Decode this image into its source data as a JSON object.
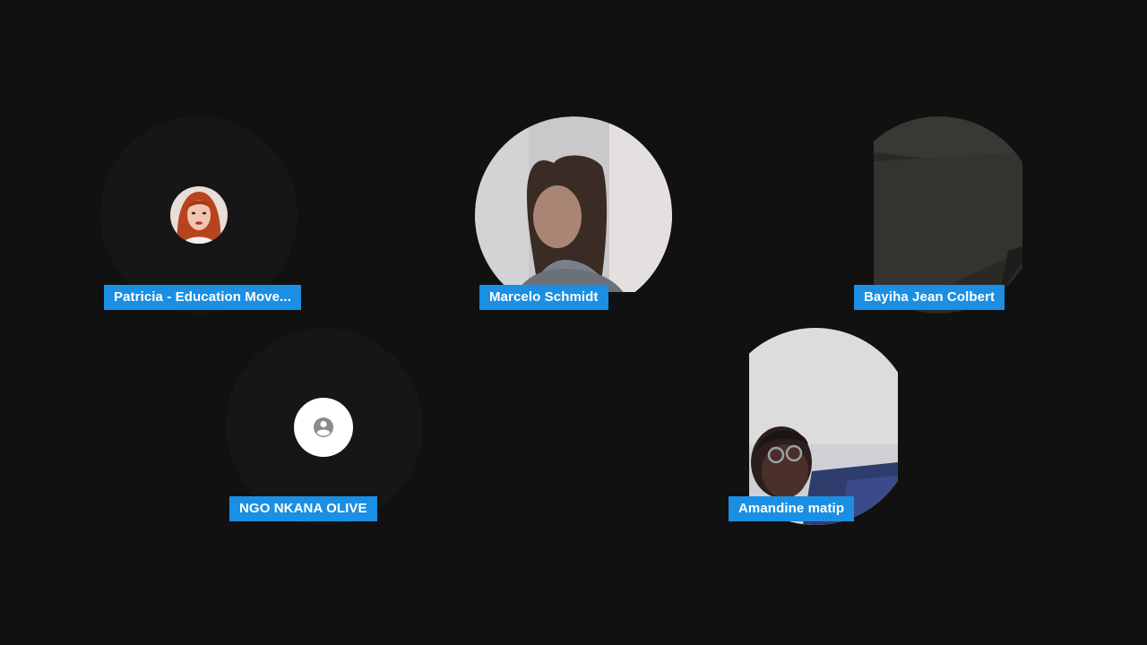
{
  "participants": [
    {
      "name": "Patricia - Education Move...",
      "media": "profile-photo"
    },
    {
      "name": "Marcelo Schmidt",
      "media": "camera-video"
    },
    {
      "name": "Bayiha Jean Colbert",
      "media": "camera-video"
    },
    {
      "name": "NGO NKANA OLIVE",
      "media": "no-video",
      "icon": "person-placeholder-icon"
    },
    {
      "name": "Amandine matip",
      "media": "camera-video"
    }
  ],
  "colors": {
    "background": "#111111",
    "name_tag": "#1a8fe3",
    "name_text": "#ffffff"
  }
}
